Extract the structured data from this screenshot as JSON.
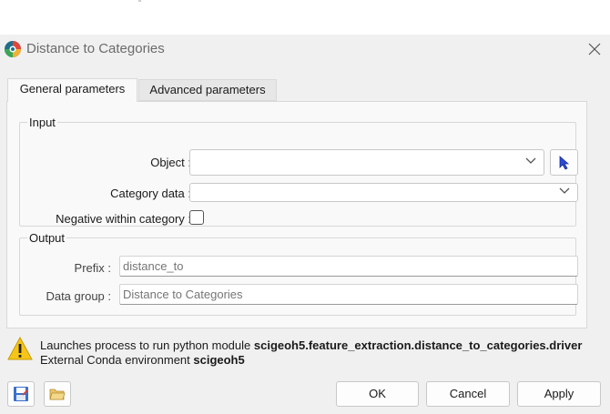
{
  "window": {
    "title": "Distance to Categories"
  },
  "tabs": [
    {
      "label": "General parameters",
      "active": true
    },
    {
      "label": "Advanced parameters",
      "active": false
    }
  ],
  "input_group": {
    "title": "Input",
    "object_label": "Object :",
    "object_value": "",
    "category_label": "Category data :",
    "category_value": "",
    "negative_label": "Negative within category :",
    "negative_checked": false
  },
  "output_group": {
    "title": "Output",
    "prefix_label": "Prefix :",
    "prefix_placeholder": "distance_to",
    "data_group_label": "Data group :",
    "data_group_placeholder": "Distance to Categories"
  },
  "info": {
    "line1_prefix": "Launches process to run python module ",
    "line1_module": "scigeoh5.feature_extraction.distance_to_categories.driver",
    "line2_prefix": "External Conda environment ",
    "line2_env": "scigeoh5"
  },
  "buttons": {
    "ok": "OK",
    "cancel": "Cancel",
    "apply": "Apply"
  },
  "icons": {
    "app": "app-logo-icon",
    "close": "close-icon",
    "pick": "pointer-cursor-icon",
    "warning": "warning-icon",
    "save": "save-icon",
    "open": "open-folder-icon"
  },
  "colors": {
    "dialog_bg": "#f0f0f0",
    "panel_bg": "#f9f9f9",
    "pick_arrow": "#2a4bd7",
    "warning": "#f5c518"
  }
}
